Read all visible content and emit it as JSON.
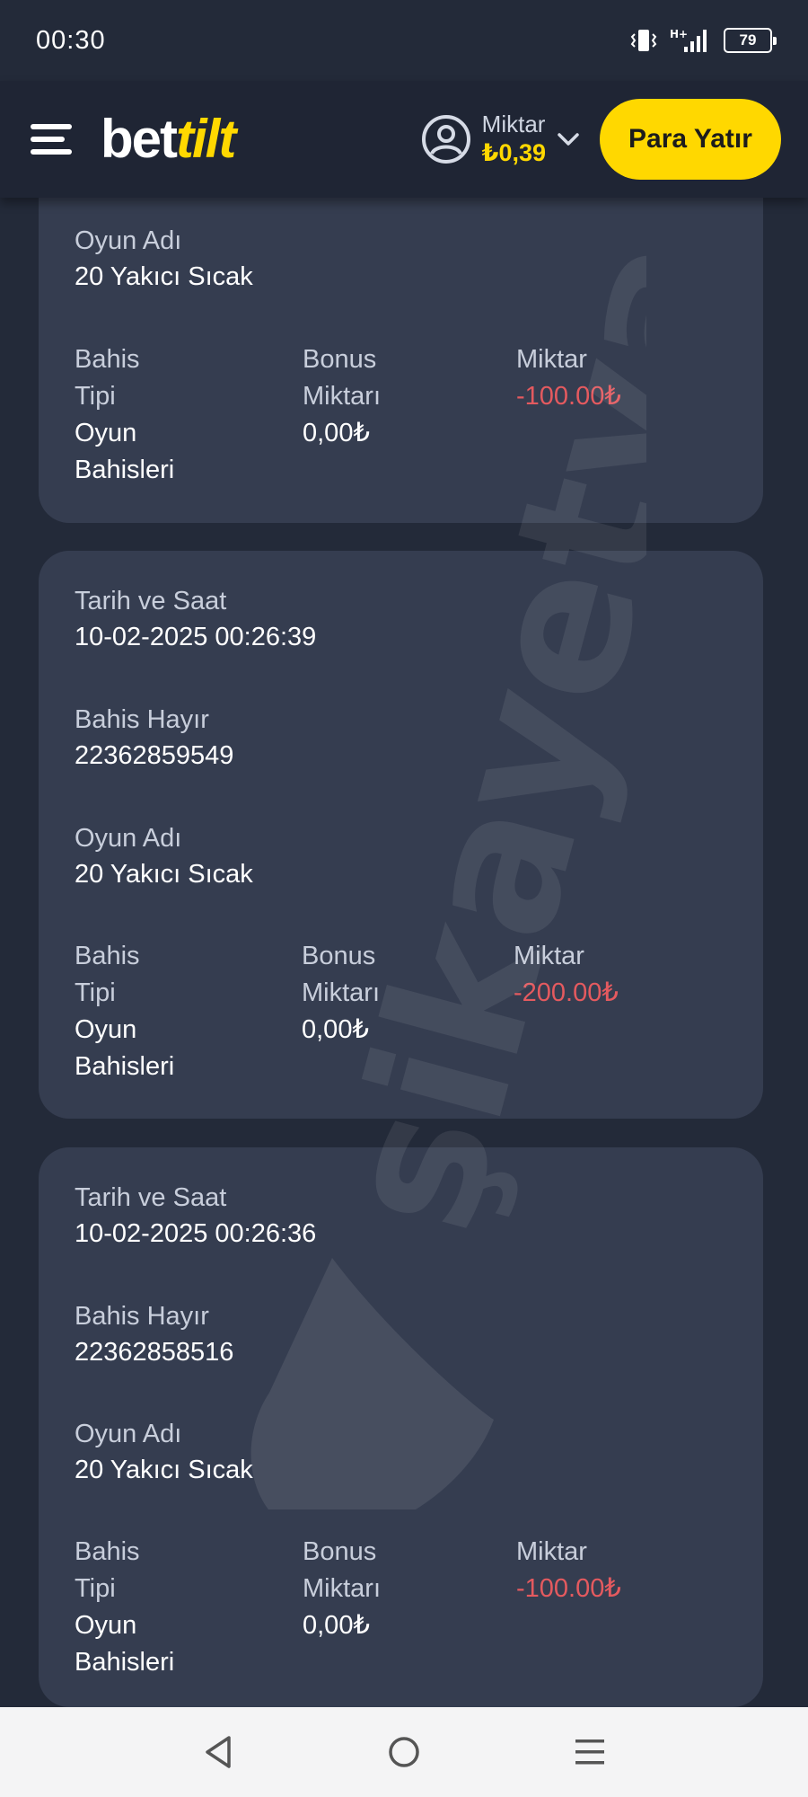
{
  "status_bar": {
    "time": "00:30",
    "network": "H+",
    "battery": "79"
  },
  "header": {
    "logo_bet": "bet",
    "logo_tilt": "tilt",
    "balance_label": "Miktar",
    "balance_value": "₺0,39",
    "deposit_label": "Para Yatır"
  },
  "cards": [
    {
      "game_label": "Oyun Adı",
      "game_value": "20 Yakıcı Sıcak",
      "type_label": "Bahis Tipi",
      "type_value": "Oyun Bahisleri",
      "bonus_label": "Bonus Miktarı",
      "bonus_value": "0,00₺",
      "amount_label": "Miktar",
      "amount_value": "-100.00₺"
    },
    {
      "date_label": "Tarih ve Saat",
      "date_value": "10-02-2025 00:26:39",
      "bet_no_label": "Bahis Hayır",
      "bet_no_value": "22362859549",
      "game_label": "Oyun Adı",
      "game_value": "20 Yakıcı Sıcak",
      "type_label": "Bahis Tipi",
      "type_value": "Oyun Bahisleri",
      "bonus_label": "Bonus Miktarı",
      "bonus_value": "0,00₺",
      "amount_label": "Miktar",
      "amount_value": "-200.00₺"
    },
    {
      "date_label": "Tarih ve Saat",
      "date_value": "10-02-2025 00:26:36",
      "bet_no_label": "Bahis Hayır",
      "bet_no_value": "22362858516",
      "game_label": "Oyun Adı",
      "game_value": "20 Yakıcı Sıcak",
      "type_label": "Bahis Tipi",
      "type_value": "Oyun Bahisleri",
      "bonus_label": "Bonus Miktarı",
      "bonus_value": "0,00₺",
      "amount_label": "Miktar",
      "amount_value": "-100.00₺"
    }
  ],
  "watermark": {
    "text": "şikayetvar"
  },
  "colors": {
    "accent": "#ffd800",
    "negative": "#e45a5f",
    "card_bg": "#353d50",
    "page_bg": "#232a39"
  },
  "nav_bar": {
    "icons": [
      "back-icon",
      "home-icon",
      "recents-icon"
    ]
  }
}
